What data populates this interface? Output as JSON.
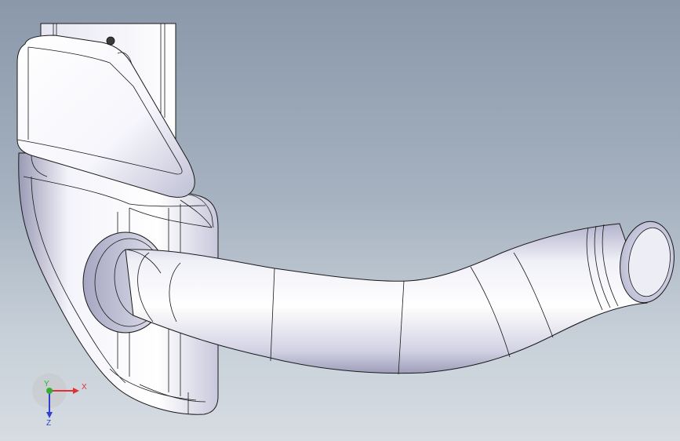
{
  "viewport": {
    "background_top": "#8a98aa",
    "background_bottom": "#d6dce2"
  },
  "model": {
    "shade_light": "#ffffff",
    "shade_mid": "#d9d9ea",
    "shade_dark": "#8c8ca8",
    "edge_color": "#1a1a1a"
  },
  "triad": {
    "x_label": "X",
    "y_label": "Y",
    "z_label": "Z",
    "x_color": "#e03030",
    "y_color": "#30b030",
    "z_color": "#3040d0"
  }
}
